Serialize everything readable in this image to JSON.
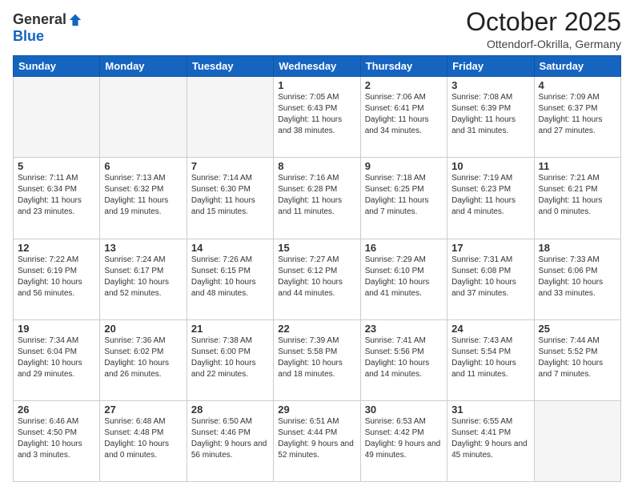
{
  "header": {
    "logo_general": "General",
    "logo_blue": "Blue",
    "month_title": "October 2025",
    "location": "Ottendorf-Okrilla, Germany"
  },
  "days_of_week": [
    "Sunday",
    "Monday",
    "Tuesday",
    "Wednesday",
    "Thursday",
    "Friday",
    "Saturday"
  ],
  "weeks": [
    [
      {
        "day": "",
        "sunrise": "",
        "sunset": "",
        "daylight": "",
        "empty": true
      },
      {
        "day": "",
        "sunrise": "",
        "sunset": "",
        "daylight": "",
        "empty": true
      },
      {
        "day": "",
        "sunrise": "",
        "sunset": "",
        "daylight": "",
        "empty": true
      },
      {
        "day": "1",
        "sunrise": "Sunrise: 7:05 AM",
        "sunset": "Sunset: 6:43 PM",
        "daylight": "Daylight: 11 hours and 38 minutes."
      },
      {
        "day": "2",
        "sunrise": "Sunrise: 7:06 AM",
        "sunset": "Sunset: 6:41 PM",
        "daylight": "Daylight: 11 hours and 34 minutes."
      },
      {
        "day": "3",
        "sunrise": "Sunrise: 7:08 AM",
        "sunset": "Sunset: 6:39 PM",
        "daylight": "Daylight: 11 hours and 31 minutes."
      },
      {
        "day": "4",
        "sunrise": "Sunrise: 7:09 AM",
        "sunset": "Sunset: 6:37 PM",
        "daylight": "Daylight: 11 hours and 27 minutes."
      }
    ],
    [
      {
        "day": "5",
        "sunrise": "Sunrise: 7:11 AM",
        "sunset": "Sunset: 6:34 PM",
        "daylight": "Daylight: 11 hours and 23 minutes."
      },
      {
        "day": "6",
        "sunrise": "Sunrise: 7:13 AM",
        "sunset": "Sunset: 6:32 PM",
        "daylight": "Daylight: 11 hours and 19 minutes."
      },
      {
        "day": "7",
        "sunrise": "Sunrise: 7:14 AM",
        "sunset": "Sunset: 6:30 PM",
        "daylight": "Daylight: 11 hours and 15 minutes."
      },
      {
        "day": "8",
        "sunrise": "Sunrise: 7:16 AM",
        "sunset": "Sunset: 6:28 PM",
        "daylight": "Daylight: 11 hours and 11 minutes."
      },
      {
        "day": "9",
        "sunrise": "Sunrise: 7:18 AM",
        "sunset": "Sunset: 6:25 PM",
        "daylight": "Daylight: 11 hours and 7 minutes."
      },
      {
        "day": "10",
        "sunrise": "Sunrise: 7:19 AM",
        "sunset": "Sunset: 6:23 PM",
        "daylight": "Daylight: 11 hours and 4 minutes."
      },
      {
        "day": "11",
        "sunrise": "Sunrise: 7:21 AM",
        "sunset": "Sunset: 6:21 PM",
        "daylight": "Daylight: 11 hours and 0 minutes."
      }
    ],
    [
      {
        "day": "12",
        "sunrise": "Sunrise: 7:22 AM",
        "sunset": "Sunset: 6:19 PM",
        "daylight": "Daylight: 10 hours and 56 minutes."
      },
      {
        "day": "13",
        "sunrise": "Sunrise: 7:24 AM",
        "sunset": "Sunset: 6:17 PM",
        "daylight": "Daylight: 10 hours and 52 minutes."
      },
      {
        "day": "14",
        "sunrise": "Sunrise: 7:26 AM",
        "sunset": "Sunset: 6:15 PM",
        "daylight": "Daylight: 10 hours and 48 minutes."
      },
      {
        "day": "15",
        "sunrise": "Sunrise: 7:27 AM",
        "sunset": "Sunset: 6:12 PM",
        "daylight": "Daylight: 10 hours and 44 minutes."
      },
      {
        "day": "16",
        "sunrise": "Sunrise: 7:29 AM",
        "sunset": "Sunset: 6:10 PM",
        "daylight": "Daylight: 10 hours and 41 minutes."
      },
      {
        "day": "17",
        "sunrise": "Sunrise: 7:31 AM",
        "sunset": "Sunset: 6:08 PM",
        "daylight": "Daylight: 10 hours and 37 minutes."
      },
      {
        "day": "18",
        "sunrise": "Sunrise: 7:33 AM",
        "sunset": "Sunset: 6:06 PM",
        "daylight": "Daylight: 10 hours and 33 minutes."
      }
    ],
    [
      {
        "day": "19",
        "sunrise": "Sunrise: 7:34 AM",
        "sunset": "Sunset: 6:04 PM",
        "daylight": "Daylight: 10 hours and 29 minutes."
      },
      {
        "day": "20",
        "sunrise": "Sunrise: 7:36 AM",
        "sunset": "Sunset: 6:02 PM",
        "daylight": "Daylight: 10 hours and 26 minutes."
      },
      {
        "day": "21",
        "sunrise": "Sunrise: 7:38 AM",
        "sunset": "Sunset: 6:00 PM",
        "daylight": "Daylight: 10 hours and 22 minutes."
      },
      {
        "day": "22",
        "sunrise": "Sunrise: 7:39 AM",
        "sunset": "Sunset: 5:58 PM",
        "daylight": "Daylight: 10 hours and 18 minutes."
      },
      {
        "day": "23",
        "sunrise": "Sunrise: 7:41 AM",
        "sunset": "Sunset: 5:56 PM",
        "daylight": "Daylight: 10 hours and 14 minutes."
      },
      {
        "day": "24",
        "sunrise": "Sunrise: 7:43 AM",
        "sunset": "Sunset: 5:54 PM",
        "daylight": "Daylight: 10 hours and 11 minutes."
      },
      {
        "day": "25",
        "sunrise": "Sunrise: 7:44 AM",
        "sunset": "Sunset: 5:52 PM",
        "daylight": "Daylight: 10 hours and 7 minutes."
      }
    ],
    [
      {
        "day": "26",
        "sunrise": "Sunrise: 6:46 AM",
        "sunset": "Sunset: 4:50 PM",
        "daylight": "Daylight: 10 hours and 3 minutes."
      },
      {
        "day": "27",
        "sunrise": "Sunrise: 6:48 AM",
        "sunset": "Sunset: 4:48 PM",
        "daylight": "Daylight: 10 hours and 0 minutes."
      },
      {
        "day": "28",
        "sunrise": "Sunrise: 6:50 AM",
        "sunset": "Sunset: 4:46 PM",
        "daylight": "Daylight: 9 hours and 56 minutes."
      },
      {
        "day": "29",
        "sunrise": "Sunrise: 6:51 AM",
        "sunset": "Sunset: 4:44 PM",
        "daylight": "Daylight: 9 hours and 52 minutes."
      },
      {
        "day": "30",
        "sunrise": "Sunrise: 6:53 AM",
        "sunset": "Sunset: 4:42 PM",
        "daylight": "Daylight: 9 hours and 49 minutes."
      },
      {
        "day": "31",
        "sunrise": "Sunrise: 6:55 AM",
        "sunset": "Sunset: 4:41 PM",
        "daylight": "Daylight: 9 hours and 45 minutes."
      },
      {
        "day": "",
        "sunrise": "",
        "sunset": "",
        "daylight": "",
        "empty": true
      }
    ]
  ]
}
